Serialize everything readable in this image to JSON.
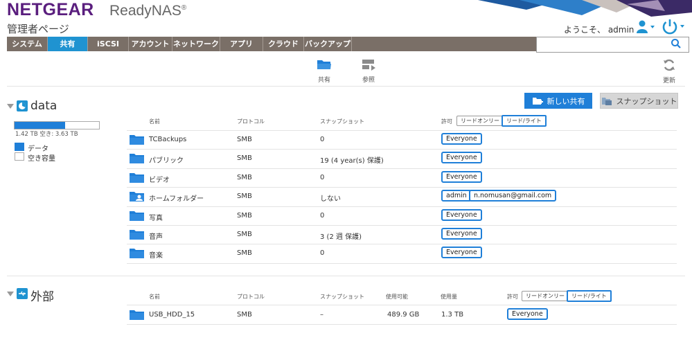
{
  "header": {
    "brand": "NETGEAR",
    "product": "ReadyNAS",
    "product_mark": "®",
    "subtitle": "管理者ページ",
    "welcome": "ようこそ、 admin",
    "user_icon": "user-icon",
    "power_icon": "power-icon"
  },
  "nav": {
    "tabs": [
      {
        "label": "システム",
        "active": false
      },
      {
        "label": "共有",
        "active": true
      },
      {
        "label": "iSCSI",
        "active": false
      },
      {
        "label": "アカウント",
        "active": false
      },
      {
        "label": "ネットワーク",
        "active": false
      },
      {
        "label": "アプリ",
        "active": false
      },
      {
        "label": "クラウド",
        "active": false
      },
      {
        "label": "バックアップ",
        "active": false
      }
    ],
    "search_placeholder": ""
  },
  "subnav": {
    "shares_label": "共有",
    "browse_label": "参照",
    "refresh_label": "更新"
  },
  "actions": {
    "new_share": "新しい共有",
    "snapshot": "スナップショット"
  },
  "volume": {
    "name": "data",
    "usage_text": "1.42 TB 空き: 3.63 TB",
    "usage_fraction": 0.6,
    "legend_data": "データ",
    "legend_free": "空き容量",
    "columns": {
      "name": "名前",
      "protocol": "プロトコル",
      "snapshot": "スナップショット",
      "permission": "許可",
      "readonly": "リードオンリー",
      "readwrite": "リード/ライト"
    },
    "rows": [
      {
        "name": "TCBackups",
        "protocol": "SMB",
        "snapshot": "0",
        "perms": [
          "Everyone"
        ],
        "icon": "folder-icon"
      },
      {
        "name": "パブリック",
        "protocol": "SMB",
        "snapshot": "19 (4 year(s) 保護)",
        "perms": [
          "Everyone"
        ],
        "icon": "folder-icon"
      },
      {
        "name": "ビデオ",
        "protocol": "SMB",
        "snapshot": "0",
        "perms": [
          "Everyone"
        ],
        "icon": "folder-icon"
      },
      {
        "name": "ホームフォルダー",
        "protocol": "SMB",
        "snapshot": "しない",
        "perms": [
          "admin",
          "n.nomusan@gmail.com"
        ],
        "icon": "home-folder-icon"
      },
      {
        "name": "写真",
        "protocol": "SMB",
        "snapshot": "0",
        "perms": [
          "Everyone"
        ],
        "icon": "folder-icon"
      },
      {
        "name": "音声",
        "protocol": "SMB",
        "snapshot": "3 (2 週 保護)",
        "perms": [
          "Everyone"
        ],
        "icon": "folder-icon"
      },
      {
        "name": "音楽",
        "protocol": "SMB",
        "snapshot": "0",
        "perms": [
          "Everyone"
        ],
        "icon": "folder-icon"
      }
    ]
  },
  "external": {
    "name": "外部",
    "columns": {
      "name": "名前",
      "protocol": "プロトコル",
      "snapshot": "スナップショット",
      "available": "使用可能",
      "used": "使用量",
      "permission": "許可",
      "readonly": "リードオンリー",
      "readwrite": "リード/ライト"
    },
    "rows": [
      {
        "name": "USB_HDD_15",
        "protocol": "SMB",
        "snapshot": "–",
        "available": "489.9 GB",
        "used": "1.3 TB",
        "perms": [
          "Everyone"
        ]
      }
    ]
  },
  "colors": {
    "accent": "#1f93d1",
    "brand": "#5a1e7e",
    "nav_bg": "#7a6f67",
    "button_blue": "#1f7fd8"
  }
}
